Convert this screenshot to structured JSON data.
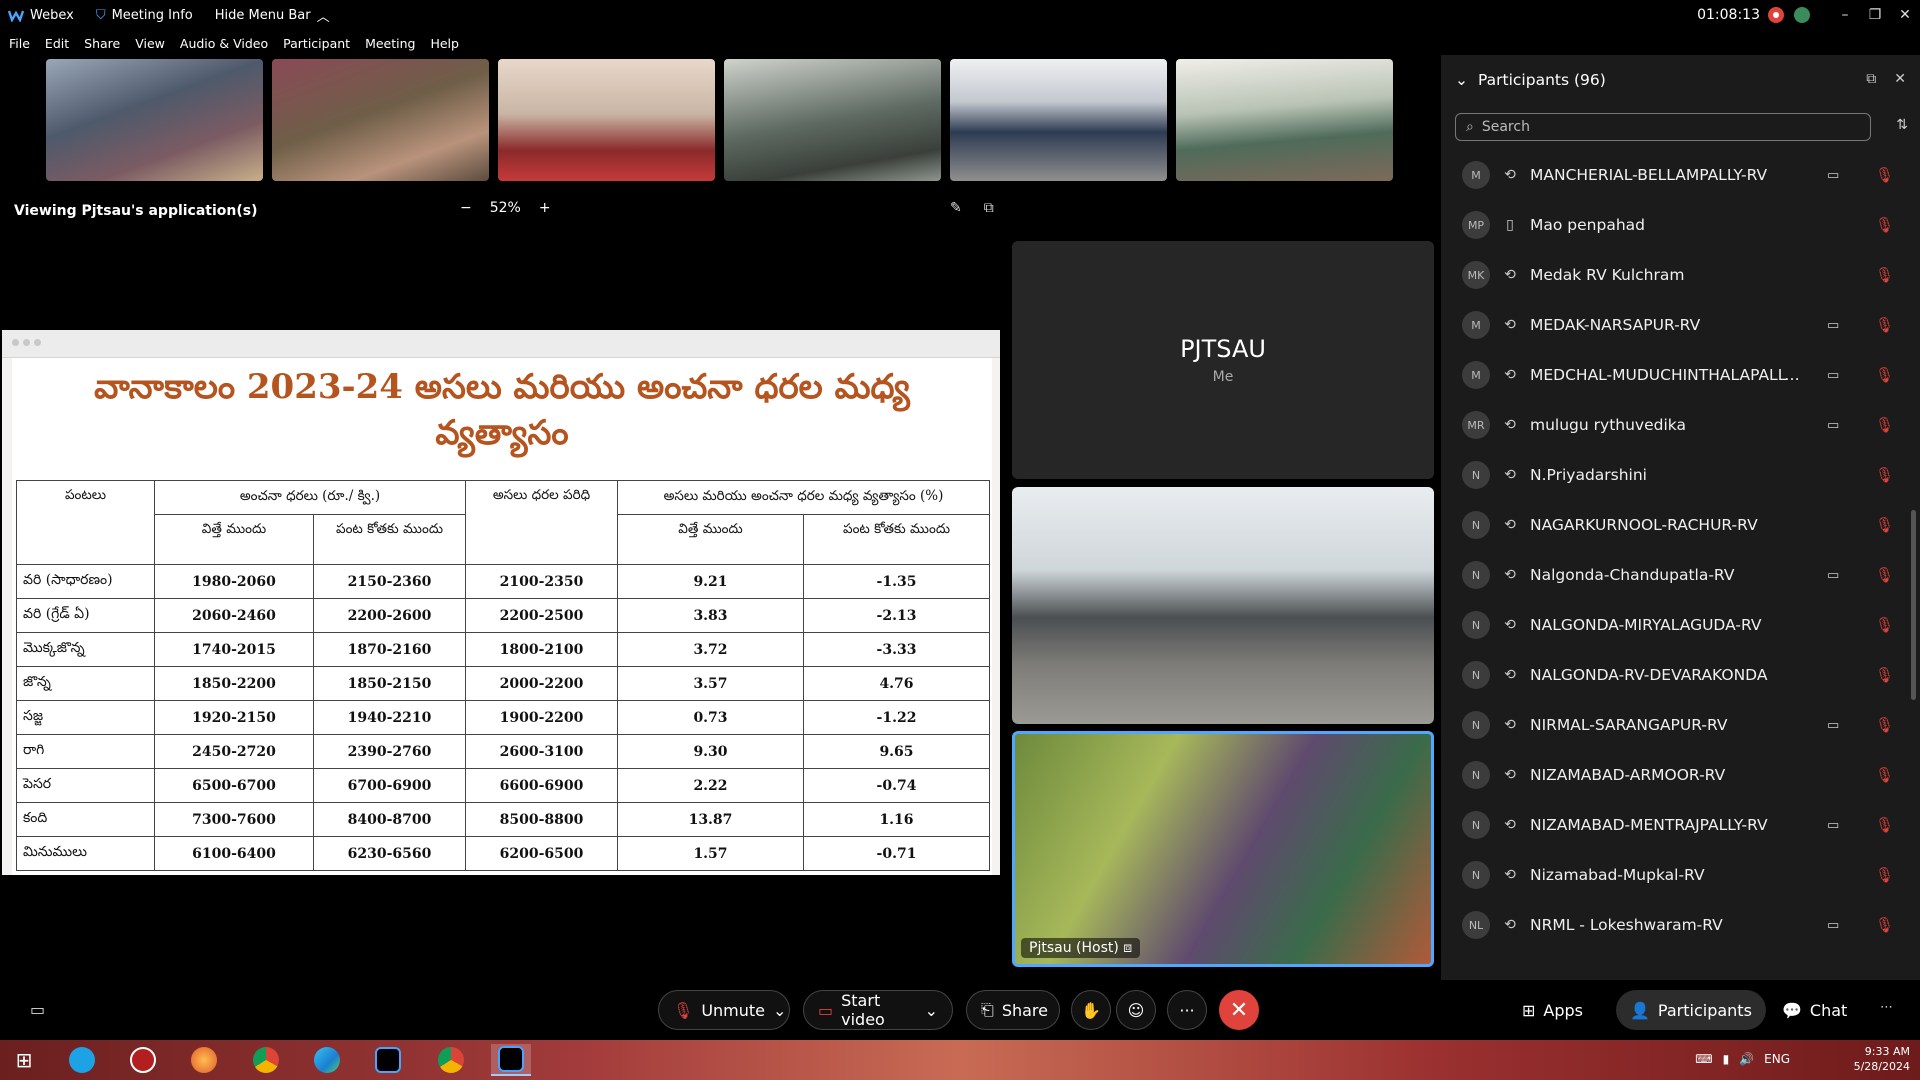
{
  "titlebar": {
    "app_name": "Webex",
    "meeting_info": "Meeting Info",
    "hide_menu": "Hide Menu Bar",
    "time": "01:08:13",
    "minimize": "–",
    "restore": "❐",
    "close": "✕"
  },
  "menu": [
    "File",
    "Edit",
    "Share",
    "View",
    "Audio & Video",
    "Participant",
    "Meeting",
    "Help"
  ],
  "viewing": {
    "label": "Viewing Pjtsau's application(s)",
    "zoom_minus": "−",
    "zoom": "52%",
    "zoom_plus": "+"
  },
  "document": {
    "title_line1": "వానాకాలం 2023-24 అసలు మరియు అంచనా ధరల మధ్య",
    "title_line2": "వ్యత్యాసం",
    "headers": {
      "crops": "పంటలు",
      "estimated": "అంచనా ధరలు (రూ./ క్వి.)",
      "actual": "అసలు ధరల పరిధి",
      "difference": "అసలు మరియు అంచనా ధరల మధ్య వ్యత్యాసం (%)",
      "before_sowing": "విత్తే ముందు",
      "before_harvest": "పంట కోతకు ముందు",
      "diff_before_sowing": "విత్తే ముందు",
      "diff_before_harvest": "పంట కోతకు ముందు"
    },
    "rows": [
      {
        "crop": "వరి (సాధారణం)",
        "sow": "1980-2060",
        "harvest": "2150-2360",
        "actual": "2100-2350",
        "d1": "9.21",
        "d2": "-1.35"
      },
      {
        "crop": "వరి (గ్రేడ్ ఏ)",
        "sow": "2060-2460",
        "harvest": "2200-2600",
        "actual": "2200-2500",
        "d1": "3.83",
        "d2": "-2.13"
      },
      {
        "crop": "మొక్కజొన్న",
        "sow": "1740-2015",
        "harvest": "1870-2160",
        "actual": "1800-2100",
        "d1": "3.72",
        "d2": "-3.33"
      },
      {
        "crop": "జొన్న",
        "sow": "1850-2200",
        "harvest": "1850-2150",
        "actual": "2000-2200",
        "d1": "3.57",
        "d2": "4.76"
      },
      {
        "crop": "సజ్జ",
        "sow": "1920-2150",
        "harvest": "1940-2210",
        "actual": "1900-2200",
        "d1": "0.73",
        "d2": "-1.22"
      },
      {
        "crop": "రాగి",
        "sow": "2450-2720",
        "harvest": "2390-2760",
        "actual": "2600-3100",
        "d1": "9.30",
        "d2": "9.65"
      },
      {
        "crop": "పెసర",
        "sow": "6500-6700",
        "harvest": "6700-6900",
        "actual": "6600-6900",
        "d1": "2.22",
        "d2": "-0.74"
      },
      {
        "crop": "కంది",
        "sow": "7300-7600",
        "harvest": "8400-8700",
        "actual": "8500-8800",
        "d1": "13.87",
        "d2": "1.16"
      },
      {
        "crop": "మినుములు",
        "sow": "6100-6400",
        "harvest": "6230-6560",
        "actual": "6200-6500",
        "d1": "1.57",
        "d2": "-0.71"
      }
    ]
  },
  "tiles": {
    "me_name": "PJTSAU",
    "me_sub": "Me",
    "host_label": "Pjtsau (Host)"
  },
  "participants": {
    "title": "Participants (96)",
    "search_placeholder": "Search",
    "list": [
      {
        "initials": "M",
        "name": "MANCHERIAL-BELLAMPALLY-RV",
        "cam": true
      },
      {
        "initials": "MP",
        "name": "Mao penpahad",
        "cam": false,
        "phone": true
      },
      {
        "initials": "MK",
        "name": "Medak RV Kulchram",
        "cam": false
      },
      {
        "initials": "M",
        "name": "MEDAK-NARSAPUR-RV",
        "cam": true
      },
      {
        "initials": "M",
        "name": "MEDCHAL-MUDUCHINTHALAPALLY-...",
        "cam": true
      },
      {
        "initials": "MR",
        "name": "mulugu rythuvedika",
        "cam": true
      },
      {
        "initials": "N",
        "name": "N.Priyadarshini",
        "cam": false
      },
      {
        "initials": "N",
        "name": "NAGARKURNOOL-RACHUR-RV",
        "cam": false
      },
      {
        "initials": "N",
        "name": "Nalgonda-Chandupatla-RV",
        "cam": true
      },
      {
        "initials": "N",
        "name": "NALGONDA-MIRYALAGUDA-RV",
        "cam": false
      },
      {
        "initials": "N",
        "name": "NALGONDA-RV-DEVARAKONDA",
        "cam": false
      },
      {
        "initials": "N",
        "name": "NIRMAL-SARANGAPUR-RV",
        "cam": true
      },
      {
        "initials": "N",
        "name": "NIZAMABAD-ARMOOR-RV",
        "cam": false
      },
      {
        "initials": "N",
        "name": "NIZAMABAD-MENTRAJPALLY-RV",
        "cam": true
      },
      {
        "initials": "N",
        "name": "Nizamabad-Mupkal-RV",
        "cam": false
      },
      {
        "initials": "NL",
        "name": "NRML - Lokeshwaram-RV",
        "cam": true
      }
    ]
  },
  "controls": {
    "unmute": "Unmute",
    "start_video": "Start video",
    "share": "Share",
    "apps": "Apps",
    "participants": "Participants",
    "chat": "Chat",
    "more": "···"
  },
  "taskbar": {
    "lang": "ENG",
    "time": "9:33 AM",
    "date": "5/28/2024"
  }
}
